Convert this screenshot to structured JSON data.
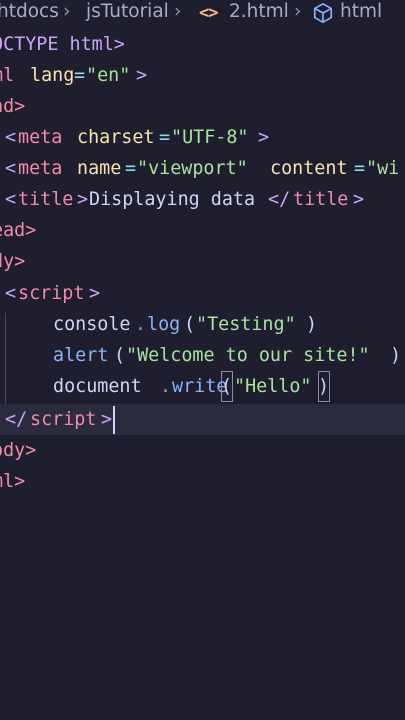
{
  "breadcrumb": {
    "segments": [
      "htdocs",
      "jsTutorial",
      "2.html",
      "html"
    ],
    "file_icon": "html-file-icon",
    "element_icon": "cube-icon",
    "separator_icon": "chevron-right-icon"
  },
  "code": {
    "lines": [
      [
        "OCTYPE html>"
      ],
      [
        "ml",
        "lang",
        "=",
        "\"en\"",
        ">"
      ],
      [
        "ad>"
      ],
      [
        "<",
        "meta",
        "charset",
        "=",
        "\"UTF-8\"",
        ">"
      ],
      [
        "<",
        "meta",
        "name",
        "=",
        "\"viewport\"",
        "content",
        "=",
        "\"wi"
      ],
      [
        "<",
        "title",
        ">",
        "Displaying data",
        "</",
        "title",
        ">"
      ],
      [
        "ead>"
      ],
      [
        "dy>"
      ],
      [
        "<",
        "script",
        ">"
      ],
      [
        "console",
        ".",
        "log",
        "(",
        "\"Testing\"",
        ")"
      ],
      [
        "alert",
        "(",
        "\"Welcome to our site!\"",
        ")"
      ],
      [
        "document",
        ".",
        "write",
        "(",
        "\"Hello\"",
        ")"
      ],
      [
        "</",
        "script",
        ">"
      ],
      [
        "ody>"
      ],
      [
        "ml>"
      ]
    ]
  },
  "theme": {
    "background": "#1e1e2e",
    "active_line": "#2a2b3c",
    "tag_bracket": "#cba6f7",
    "tag_name": "#f38ba8",
    "attribute": "#f9e2af",
    "operator": "#89dceb",
    "string": "#a6e3a1",
    "function": "#89b4fa",
    "text": "#cdd6f4"
  }
}
